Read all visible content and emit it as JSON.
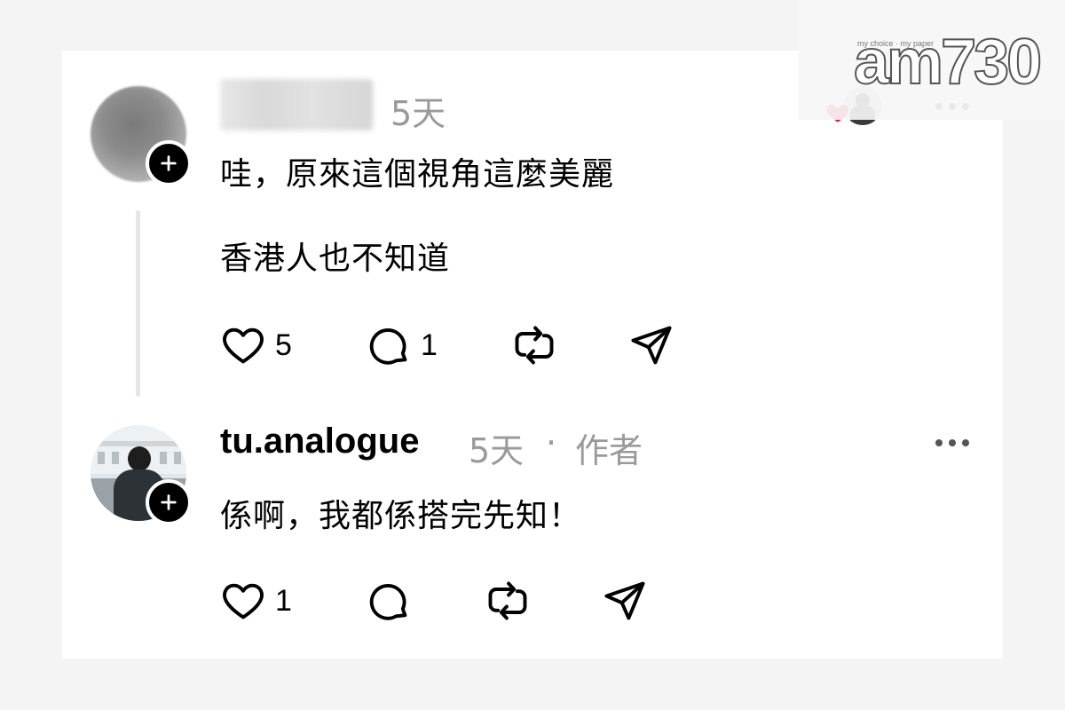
{
  "watermark": {
    "brand": "am730",
    "tagline": "my choice · my paper"
  },
  "comments": [
    {
      "username": "",
      "username_blurred": true,
      "time": "5天",
      "lines": [
        "哇，原來這個視角這麼美麗",
        "香港人也不知道"
      ],
      "actions": {
        "likes": "5",
        "replies": "1"
      }
    },
    {
      "username": "tu.analogue",
      "time": "5天",
      "separator": "·",
      "author_tag": "作者",
      "lines": [
        "係啊，我都係搭完先知！"
      ],
      "actions": {
        "likes": "1",
        "replies": ""
      }
    }
  ],
  "icons": {
    "follow": "plus-icon",
    "like": "heart-icon",
    "reply": "comment-bubble-icon",
    "repost": "repost-icon",
    "share": "send-icon",
    "more": "more-dots-icon",
    "liked_by_author": "red-heart-icon"
  },
  "colors": {
    "text": "#000000",
    "meta": "#9a9a9a",
    "heart": "#e8202b",
    "badge": "#000000"
  }
}
